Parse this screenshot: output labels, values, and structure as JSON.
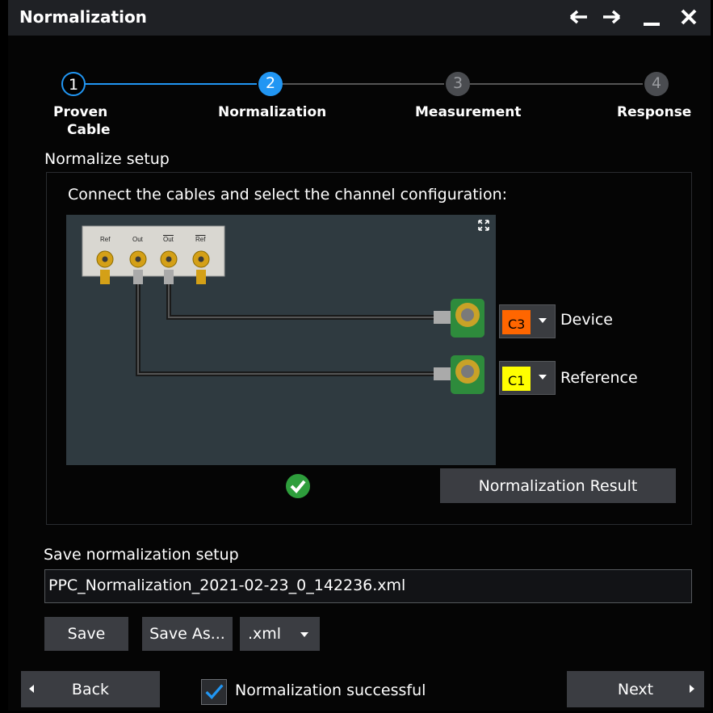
{
  "window": {
    "title": "Normalization",
    "icons": [
      "back-arrow-icon",
      "forward-arrow-icon",
      "minimize-icon",
      "close-icon"
    ]
  },
  "stepper": {
    "steps": [
      {
        "number": "1",
        "label_line1": "Proven",
        "label_line2": "Cable",
        "state": "done"
      },
      {
        "number": "2",
        "label_line1": "Normalization",
        "label_line2": "",
        "state": "active"
      },
      {
        "number": "3",
        "label_line1": "Measurement",
        "label_line2": "",
        "state": "pending"
      },
      {
        "number": "4",
        "label_line1": "Response",
        "label_line2": "",
        "state": "pending"
      }
    ]
  },
  "setup": {
    "section_title": "Normalize setup",
    "instruction": "Connect the cables and select the channel configuration:",
    "connector_labels": [
      "Ref",
      "Out",
      "Out",
      "Ref"
    ],
    "device": {
      "channel": "C3",
      "color": "#ff6600",
      "label": "Device"
    },
    "reference": {
      "channel": "C1",
      "color": "#ffff00",
      "label": "Reference"
    },
    "status_icon": "checkmark-circle-icon",
    "result_button": "Normalization Result"
  },
  "save": {
    "section_title": "Save normalization setup",
    "filename": "PPC_Normalization_2021-02-23_0_142236.xml",
    "save_label": "Save",
    "save_as_label": "Save As...",
    "extension": ".xml"
  },
  "footer": {
    "back_label": "Back",
    "status_checked": true,
    "status_label": "Normalization successful",
    "next_label": "Next"
  },
  "colors": {
    "accent": "#2196f3",
    "success": "#2e9e3c",
    "panel": "#1f2125"
  }
}
